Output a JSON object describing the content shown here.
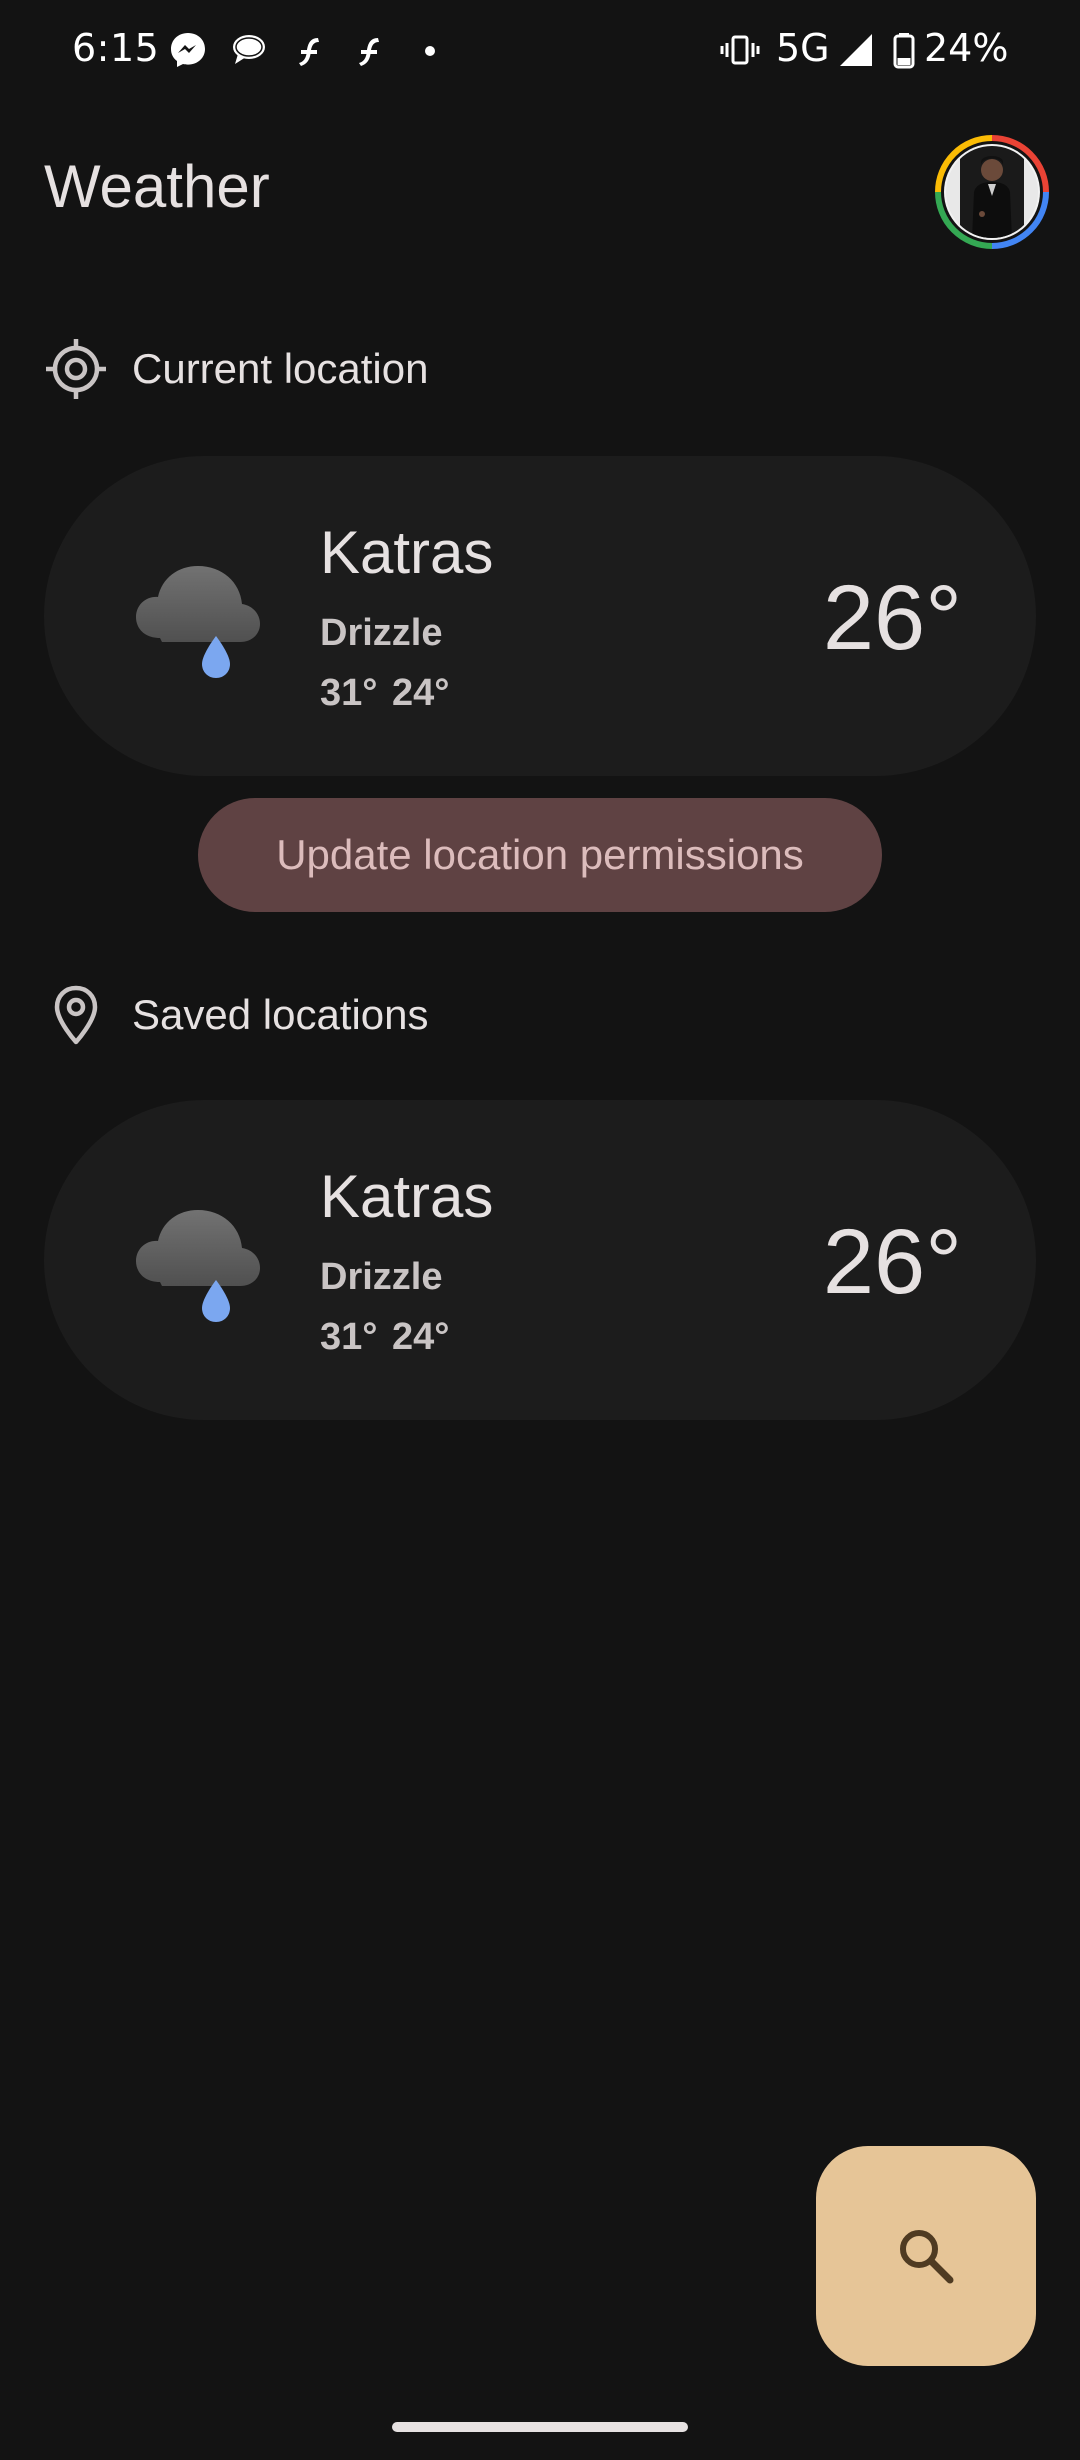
{
  "status_bar": {
    "time": "6:15",
    "network": "5G",
    "battery": "24%",
    "icons": [
      "messenger-icon",
      "chat-bubble-icon",
      "fork-app-icon",
      "fork-app-icon",
      "notification-dot-icon",
      "vibrate-icon",
      "signal-icon",
      "battery-icon"
    ]
  },
  "header": {
    "title": "Weather",
    "avatar": "account-avatar"
  },
  "current_location": {
    "section_label": "Current location",
    "section_icon": "my-location-icon",
    "card": {
      "city": "Katras",
      "condition": "Drizzle",
      "range": "31° 24°",
      "temperature": "26°",
      "icon": "drizzle-icon"
    },
    "permission_button": "Update location permissions"
  },
  "saved_locations": {
    "section_label": "Saved locations",
    "section_icon": "location-pin-icon",
    "cards": [
      {
        "city": "Katras",
        "condition": "Drizzle",
        "range": "31° 24°",
        "temperature": "26°",
        "icon": "drizzle-icon"
      }
    ]
  },
  "fab": {
    "icon": "search-icon"
  },
  "colors": {
    "background": "#131313",
    "card": "#1c1c1c",
    "permission_chip": "#5f4243",
    "permission_text": "#dcbcbc",
    "fab": "#e6c597",
    "drop": "#7ba7f0"
  }
}
